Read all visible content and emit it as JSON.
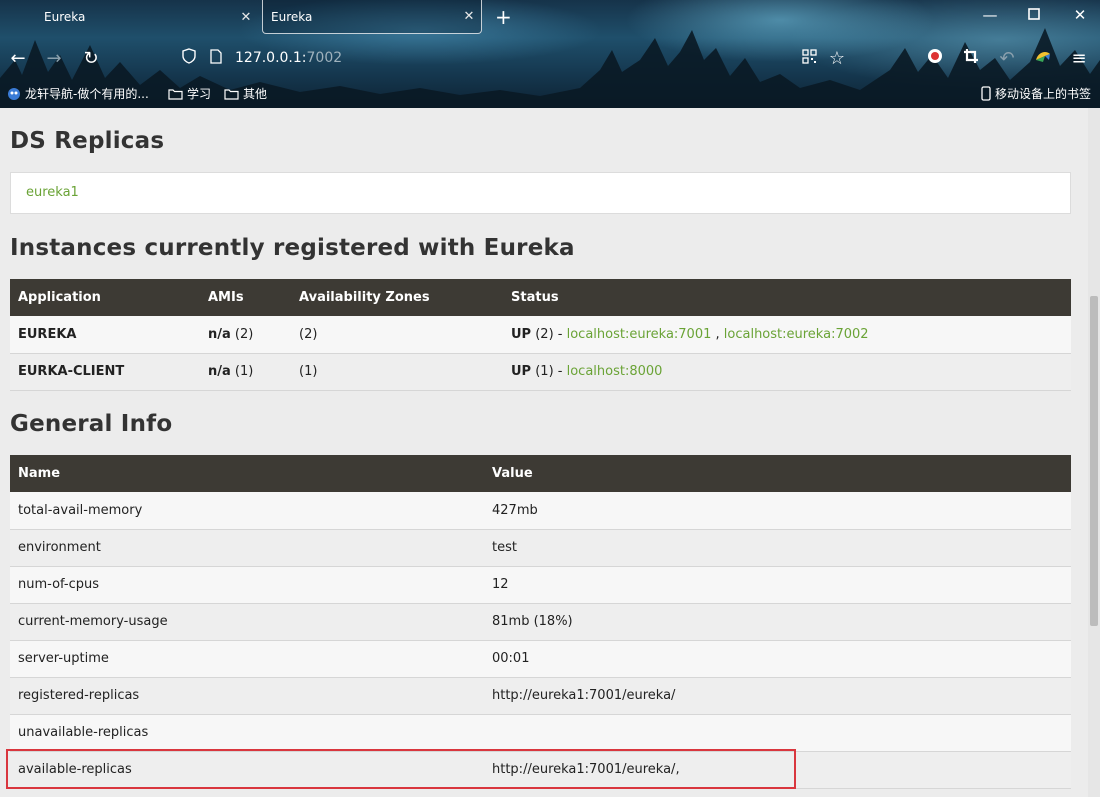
{
  "browser": {
    "tabs": [
      {
        "title": "Eureka",
        "close": "✕"
      },
      {
        "title": "Eureka",
        "close": "✕"
      }
    ],
    "new_tab": "+",
    "url_host": "127.0.0.1:",
    "url_port": "7002",
    "bookmarks": [
      {
        "label": "龙轩导航-做个有用的...",
        "icon": "site-icon"
      },
      {
        "label": "学习",
        "icon": "folder-icon"
      },
      {
        "label": "其他",
        "icon": "folder-icon"
      }
    ],
    "mobile_bookmarks": "移动设备上的书签"
  },
  "ds_replicas": {
    "heading": "DS Replicas",
    "items": [
      "eureka1"
    ]
  },
  "instances": {
    "heading": "Instances currently registered with Eureka",
    "columns": [
      "Application",
      "AMIs",
      "Availability Zones",
      "Status"
    ],
    "rows": [
      {
        "app": "EUREKA",
        "amis_bold": "n/a",
        "amis_count": " (2)",
        "zones": "(2)",
        "status_bold": "UP",
        "status_count": " (2) - ",
        "link1": "localhost:eureka:7001",
        "sep": " , ",
        "link2": "localhost:eureka:7002"
      },
      {
        "app": "EURKA-CLIENT",
        "amis_bold": "n/a",
        "amis_count": " (1)",
        "zones": "(1)",
        "status_bold": "UP",
        "status_count": " (1) - ",
        "link1": "localhost:8000"
      }
    ]
  },
  "general_info": {
    "heading": "General Info",
    "columns": [
      "Name",
      "Value"
    ],
    "rows": [
      {
        "name": "total-avail-memory",
        "value": "427mb"
      },
      {
        "name": "environment",
        "value": "test"
      },
      {
        "name": "num-of-cpus",
        "value": "12"
      },
      {
        "name": "current-memory-usage",
        "value": "81mb (18%)"
      },
      {
        "name": "server-uptime",
        "value": "00:01"
      },
      {
        "name": "registered-replicas",
        "value": "http://eureka1:7001/eureka/"
      },
      {
        "name": "unavailable-replicas",
        "value": ""
      },
      {
        "name": "available-replicas",
        "value": "http://eureka1:7001/eureka/,"
      }
    ]
  },
  "colors": {
    "accent_link": "#6aa336",
    "table_header": "#3d3a34",
    "highlight": "#d9363e"
  }
}
